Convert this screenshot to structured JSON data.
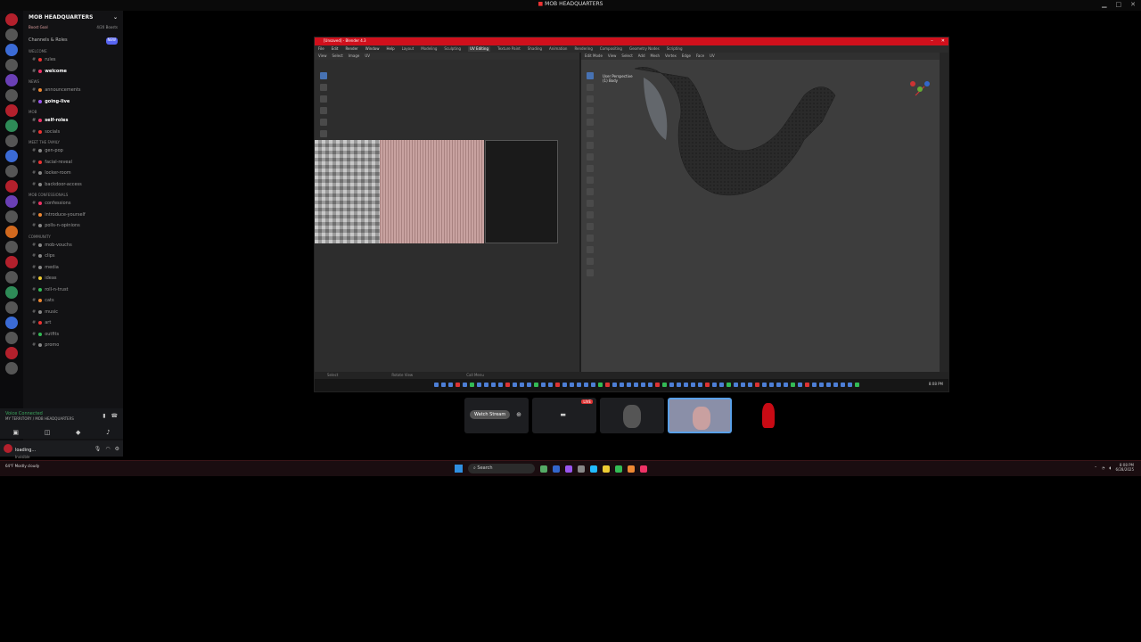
{
  "window": {
    "title": "MOB HEADQUARTERS"
  },
  "discord": {
    "server_name": "MOB HEADQUARTERS",
    "boost_goal": "Boost Goal",
    "boosts": "4/20 Boosts",
    "channels_roles": "Channels & Roles",
    "new_badge": "NEW",
    "categories": [
      {
        "name": "WELCOME",
        "channels": [
          {
            "name": "rules",
            "color": "#e33",
            "bright": false
          },
          {
            "name": "welcome",
            "color": "#e36",
            "bright": true
          }
        ]
      },
      {
        "name": "NEWS",
        "channels": [
          {
            "name": "announcements",
            "color": "#e83",
            "bright": false
          },
          {
            "name": "going-live",
            "color": "#95e",
            "bright": true
          }
        ]
      },
      {
        "name": "MOB",
        "channels": [
          {
            "name": "self-roles",
            "color": "#e36",
            "bright": true
          },
          {
            "name": "socials",
            "color": "#e33",
            "bright": false
          }
        ]
      },
      {
        "name": "Meet the family",
        "channels": [
          {
            "name": "gen-pop",
            "color": "#888",
            "bright": false
          },
          {
            "name": "facial-reveal",
            "color": "#e33",
            "bright": false
          },
          {
            "name": "locker-room",
            "color": "#888",
            "bright": false
          },
          {
            "name": "backdoor-access",
            "color": "#888",
            "bright": false
          }
        ]
      },
      {
        "name": "Mob Confessionals",
        "channels": [
          {
            "name": "confessions",
            "color": "#e36",
            "bright": false
          },
          {
            "name": "introduce-yourself",
            "color": "#e83",
            "bright": false
          },
          {
            "name": "polls-n-opinions",
            "color": "#888",
            "bright": false
          }
        ]
      },
      {
        "name": "COMMUNITY",
        "channels": [
          {
            "name": "mob-vouchs",
            "color": "#888",
            "bright": false
          },
          {
            "name": "clips",
            "color": "#888",
            "bright": false
          },
          {
            "name": "media",
            "color": "#888",
            "bright": false
          },
          {
            "name": "ideas",
            "color": "#ec3",
            "bright": false
          },
          {
            "name": "roll-n-trust",
            "color": "#3b5",
            "bright": false
          },
          {
            "name": "cats",
            "color": "#e83",
            "bright": false
          },
          {
            "name": "music",
            "color": "#888",
            "bright": false
          },
          {
            "name": "art",
            "color": "#e33",
            "bright": false
          },
          {
            "name": "outfits",
            "color": "#3b5",
            "bright": false
          },
          {
            "name": "promo",
            "color": "#888",
            "bright": false
          }
        ]
      }
    ],
    "voice": {
      "status": "Voice Connected",
      "channel": "MY TERRITORY / MOB HEADQUARTERS"
    },
    "user": {
      "name": "loading...",
      "status": "Invisible"
    }
  },
  "blender": {
    "title": "[Unsaved] - Blender 4.3",
    "menu": [
      "File",
      "Edit",
      "Render",
      "Window",
      "Help"
    ],
    "workspaces": [
      "Layout",
      "Modeling",
      "Sculpting",
      "UV Editing",
      "Texture Paint",
      "Shading",
      "Animation",
      "Rendering",
      "Compositing",
      "Geometry Nodes",
      "Scripting"
    ],
    "active_workspace": "UV Editing",
    "uv_header": [
      "View",
      "Select",
      "Image",
      "UV"
    ],
    "vp_header": [
      "Edit Mode",
      "View",
      "Select",
      "Add",
      "Mesh",
      "Vertex",
      "Edge",
      "Face",
      "UV"
    ],
    "viewport_label": "User Perspective",
    "viewport_sub": "(1) Body",
    "status": [
      "Select",
      "Rotate View",
      "Call Menu"
    ],
    "clock": "8:08 PM"
  },
  "stream": {
    "watch_label": "Watch Stream",
    "live_badge": "LIVE"
  },
  "taskbar": {
    "weather": "64°F Mostly cloudy",
    "search_placeholder": "Search",
    "time": "8:08 PM",
    "date": "6/28/2025"
  }
}
